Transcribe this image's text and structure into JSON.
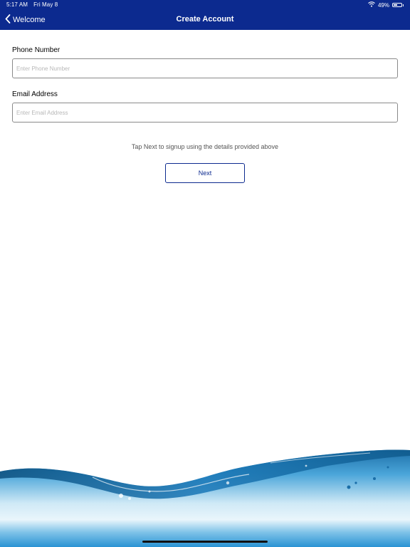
{
  "status_bar": {
    "time": "5:17 AM",
    "date": "Fri May 8",
    "battery": "49%",
    "battery_level": 0.49
  },
  "nav": {
    "back_label": "Welcome",
    "title": "Create Account"
  },
  "form": {
    "phone_label": "Phone Number",
    "phone_placeholder": "Enter Phone Number",
    "phone_value": "",
    "email_label": "Email Address",
    "email_placeholder": "Enter Email Address",
    "email_value": ""
  },
  "hint": "Tap Next to signup using the details provided above",
  "next_label": "Next",
  "colors": {
    "nav_bg": "#0c2a8f",
    "accent": "#0c2a8f",
    "water": "#2b8fd1"
  },
  "icons": {
    "back": "chevron-left-icon",
    "wifi": "wifi-icon",
    "battery": "battery-icon"
  }
}
